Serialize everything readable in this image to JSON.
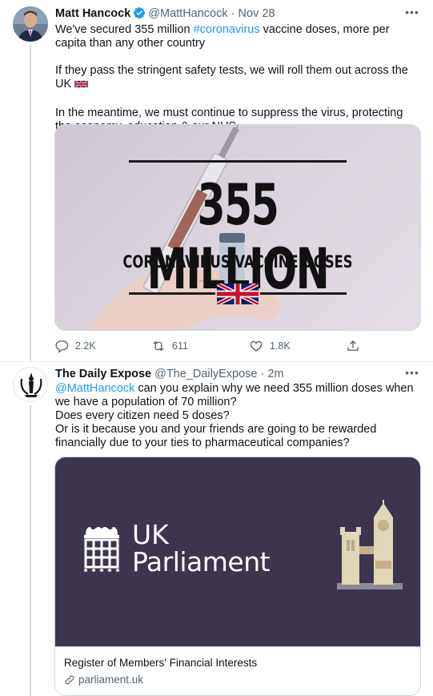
{
  "tweet1": {
    "author_name": "Matt Hancock",
    "handle": "@MattHancock",
    "separator": "·",
    "time": "Nov 28",
    "text_line1_prefix": "We've secured 355 million ",
    "hashtag": "#coronavirus",
    "text_line1_suffix": " vaccine doses, more per capita than any other country",
    "paragraph2": "If they pass the stringent safety tests, we will roll them out across the UK",
    "paragraph2_emoji": "uk-flag-emoji",
    "paragraph3": "In the meantime, we must continue to suppress the virus, protecting the economy, education & our NHS",
    "image": {
      "headline": "355 MILLION",
      "subline": "CORONAVIRUS VACCINE DOSES",
      "flag": "uk-flag-icon"
    },
    "actions": {
      "reply_count": "2.2K",
      "retweet_count": "611",
      "like_count": "1.8K"
    }
  },
  "tweet2": {
    "author_name": "The Daily Expose",
    "handle": "@The_DailyExpose",
    "separator": "·",
    "time": "2m",
    "mention": "@MattHancock",
    "text_after_mention": " can you explain why we need 355 million doses when we have a population of 70 million?",
    "line2": "Does every citizen need 5 doses?",
    "line3": "Or is it because you and your friends are going to be rewarded financially due to your ties to pharmaceutical companies?",
    "card": {
      "brand_line1": "UK",
      "brand_line2": "Parliament",
      "title": "Register of Members' Financial Interests",
      "domain": "parliament.uk",
      "background": "#3d3450"
    }
  },
  "colors": {
    "accent": "#1d9bf0",
    "secondary_text": "#536471",
    "border": "#cfd9de"
  }
}
